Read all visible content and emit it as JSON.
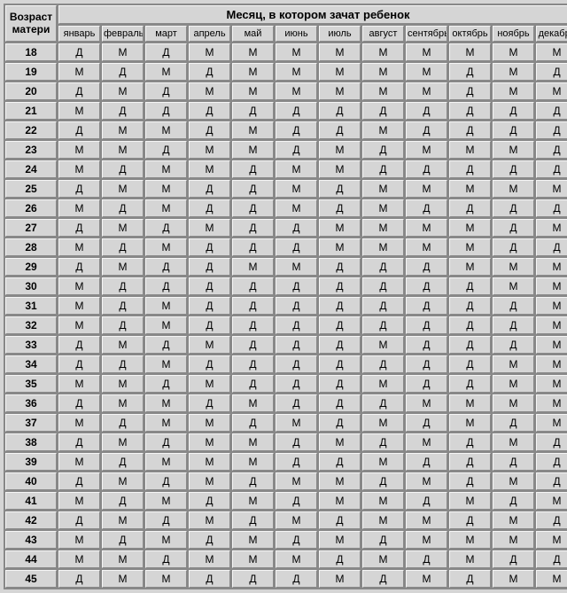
{
  "header": {
    "corner_line1": "Возраст",
    "corner_line2": "матери",
    "banner": "Месяц, в котором зачат ребенок"
  },
  "months": [
    "январь",
    "февраль",
    "март",
    "апрель",
    "май",
    "июнь",
    "июль",
    "август",
    "сентябрь",
    "октябрь",
    "ноябрь",
    "декабрь"
  ],
  "rows": [
    {
      "age": "18",
      "vals": [
        "Д",
        "М",
        "Д",
        "М",
        "М",
        "М",
        "М",
        "М",
        "М",
        "М",
        "М",
        "М"
      ]
    },
    {
      "age": "19",
      "vals": [
        "М",
        "Д",
        "М",
        "Д",
        "М",
        "М",
        "М",
        "М",
        "М",
        "Д",
        "М",
        "Д"
      ]
    },
    {
      "age": "20",
      "vals": [
        "Д",
        "М",
        "Д",
        "М",
        "М",
        "М",
        "М",
        "М",
        "М",
        "Д",
        "М",
        "М"
      ]
    },
    {
      "age": "21",
      "vals": [
        "М",
        "Д",
        "Д",
        "Д",
        "Д",
        "Д",
        "Д",
        "Д",
        "Д",
        "Д",
        "Д",
        "Д"
      ]
    },
    {
      "age": "22",
      "vals": [
        "Д",
        "М",
        "М",
        "Д",
        "М",
        "Д",
        "Д",
        "М",
        "Д",
        "Д",
        "Д",
        "Д"
      ]
    },
    {
      "age": "23",
      "vals": [
        "М",
        "М",
        "Д",
        "М",
        "М",
        "Д",
        "М",
        "Д",
        "М",
        "М",
        "М",
        "Д"
      ]
    },
    {
      "age": "24",
      "vals": [
        "М",
        "Д",
        "М",
        "М",
        "Д",
        "М",
        "М",
        "Д",
        "Д",
        "Д",
        "Д",
        "Д"
      ]
    },
    {
      "age": "25",
      "vals": [
        "Д",
        "М",
        "М",
        "Д",
        "Д",
        "М",
        "Д",
        "М",
        "М",
        "М",
        "М",
        "М"
      ]
    },
    {
      "age": "26",
      "vals": [
        "М",
        "Д",
        "М",
        "Д",
        "Д",
        "М",
        "Д",
        "М",
        "Д",
        "Д",
        "Д",
        "Д"
      ]
    },
    {
      "age": "27",
      "vals": [
        "Д",
        "М",
        "Д",
        "М",
        "Д",
        "Д",
        "М",
        "М",
        "М",
        "М",
        "Д",
        "М"
      ]
    },
    {
      "age": "28",
      "vals": [
        "М",
        "Д",
        "М",
        "Д",
        "Д",
        "Д",
        "М",
        "М",
        "М",
        "М",
        "Д",
        "Д"
      ]
    },
    {
      "age": "29",
      "vals": [
        "Д",
        "М",
        "Д",
        "Д",
        "М",
        "М",
        "Д",
        "Д",
        "Д",
        "М",
        "М",
        "М"
      ]
    },
    {
      "age": "30",
      "vals": [
        "М",
        "Д",
        "Д",
        "Д",
        "Д",
        "Д",
        "Д",
        "Д",
        "Д",
        "Д",
        "М",
        "М"
      ]
    },
    {
      "age": "31",
      "vals": [
        "М",
        "Д",
        "М",
        "Д",
        "Д",
        "Д",
        "Д",
        "Д",
        "Д",
        "Д",
        "Д",
        "М"
      ]
    },
    {
      "age": "32",
      "vals": [
        "М",
        "Д",
        "М",
        "Д",
        "Д",
        "Д",
        "Д",
        "Д",
        "Д",
        "Д",
        "Д",
        "М"
      ]
    },
    {
      "age": "33",
      "vals": [
        "Д",
        "М",
        "Д",
        "М",
        "Д",
        "Д",
        "Д",
        "М",
        "Д",
        "Д",
        "Д",
        "М"
      ]
    },
    {
      "age": "34",
      "vals": [
        "Д",
        "Д",
        "М",
        "Д",
        "Д",
        "Д",
        "Д",
        "Д",
        "Д",
        "Д",
        "М",
        "М"
      ]
    },
    {
      "age": "35",
      "vals": [
        "М",
        "М",
        "Д",
        "М",
        "Д",
        "Д",
        "Д",
        "М",
        "Д",
        "Д",
        "М",
        "М"
      ]
    },
    {
      "age": "36",
      "vals": [
        "Д",
        "М",
        "М",
        "Д",
        "М",
        "Д",
        "Д",
        "Д",
        "М",
        "М",
        "М",
        "М"
      ]
    },
    {
      "age": "37",
      "vals": [
        "М",
        "Д",
        "М",
        "М",
        "Д",
        "М",
        "Д",
        "М",
        "Д",
        "М",
        "Д",
        "М"
      ]
    },
    {
      "age": "38",
      "vals": [
        "Д",
        "М",
        "Д",
        "М",
        "М",
        "Д",
        "М",
        "Д",
        "М",
        "Д",
        "М",
        "Д"
      ]
    },
    {
      "age": "39",
      "vals": [
        "М",
        "Д",
        "М",
        "М",
        "М",
        "Д",
        "Д",
        "М",
        "Д",
        "Д",
        "Д",
        "Д"
      ]
    },
    {
      "age": "40",
      "vals": [
        "Д",
        "М",
        "Д",
        "М",
        "Д",
        "М",
        "М",
        "Д",
        "М",
        "Д",
        "М",
        "Д"
      ]
    },
    {
      "age": "41",
      "vals": [
        "М",
        "Д",
        "М",
        "Д",
        "М",
        "Д",
        "М",
        "М",
        "Д",
        "М",
        "Д",
        "М"
      ]
    },
    {
      "age": "42",
      "vals": [
        "Д",
        "М",
        "Д",
        "М",
        "Д",
        "М",
        "Д",
        "М",
        "М",
        "Д",
        "М",
        "Д"
      ]
    },
    {
      "age": "43",
      "vals": [
        "М",
        "Д",
        "М",
        "Д",
        "М",
        "Д",
        "М",
        "Д",
        "М",
        "М",
        "М",
        "М"
      ]
    },
    {
      "age": "44",
      "vals": [
        "М",
        "М",
        "Д",
        "М",
        "М",
        "М",
        "Д",
        "М",
        "Д",
        "М",
        "Д",
        "Д"
      ]
    },
    {
      "age": "45",
      "vals": [
        "Д",
        "М",
        "М",
        "Д",
        "Д",
        "Д",
        "М",
        "Д",
        "М",
        "Д",
        "М",
        "М"
      ]
    }
  ]
}
